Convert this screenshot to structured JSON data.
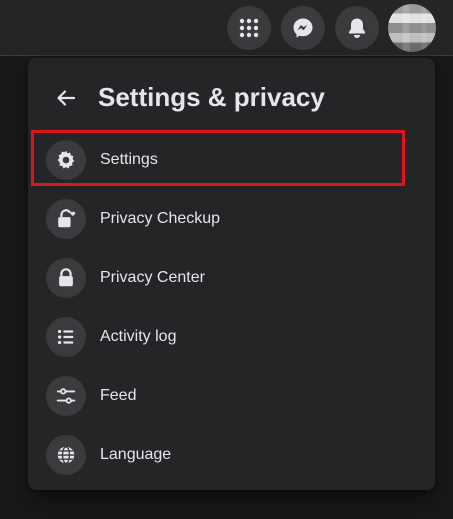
{
  "topbar": {
    "buttons": [
      {
        "icon": "menu-grid-icon"
      },
      {
        "icon": "messenger-icon"
      },
      {
        "icon": "notifications-bell-icon"
      }
    ],
    "avatar": "profile-avatar"
  },
  "panel": {
    "title": "Settings & privacy",
    "back_icon": "arrow-left-icon",
    "items": [
      {
        "label": "Settings",
        "icon": "gear-icon"
      },
      {
        "label": "Privacy Checkup",
        "icon": "lock-heart-icon"
      },
      {
        "label": "Privacy Center",
        "icon": "lock-icon"
      },
      {
        "label": "Activity log",
        "icon": "list-icon"
      },
      {
        "label": "Feed",
        "icon": "sliders-icon"
      },
      {
        "label": "Language",
        "icon": "globe-icon"
      }
    ]
  },
  "annotation": {
    "color": "#e0141b",
    "highlighted_item": "Settings"
  },
  "colors": {
    "background": "#18191a",
    "surface": "#242526",
    "icon_bg": "#3a3b3c",
    "text": "#e4e6eb"
  }
}
